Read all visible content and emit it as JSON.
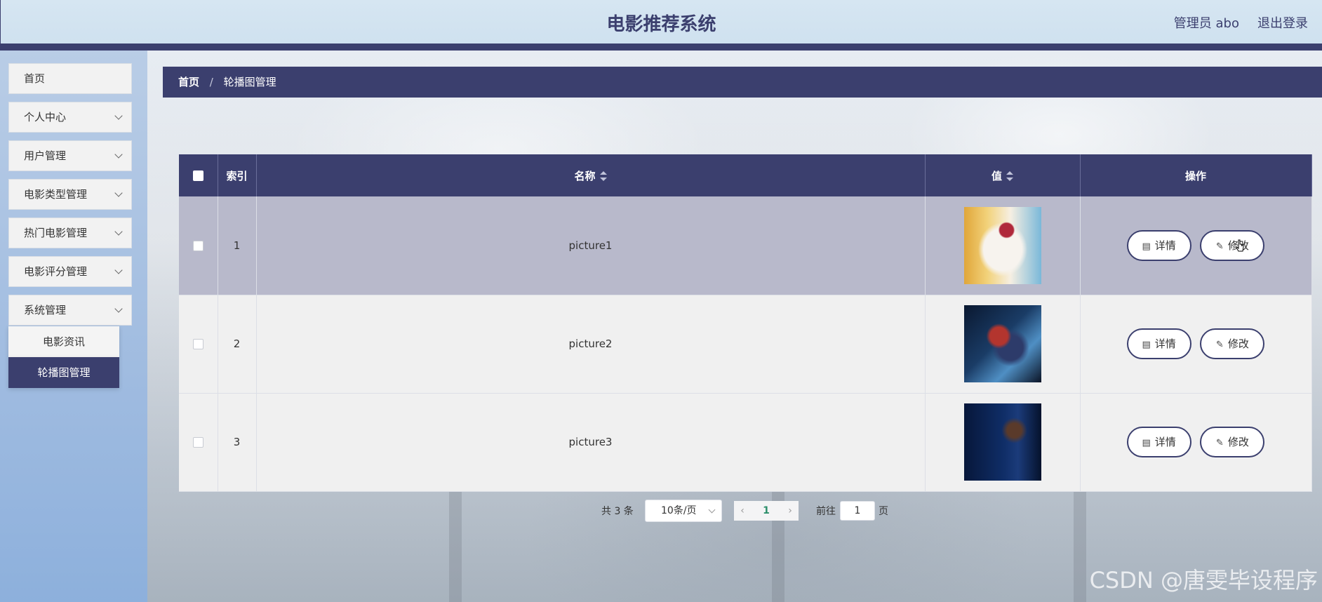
{
  "header": {
    "title": "电影推荐系统",
    "user": "管理员 abo",
    "logout": "退出登录"
  },
  "sidebar": {
    "items": [
      {
        "label": "首页"
      },
      {
        "label": "个人中心"
      },
      {
        "label": "用户管理"
      },
      {
        "label": "电影类型管理"
      },
      {
        "label": "热门电影管理"
      },
      {
        "label": "电影评分管理"
      },
      {
        "label": "系统管理"
      }
    ],
    "submenu": [
      {
        "label": "电影资讯",
        "active": false
      },
      {
        "label": "轮播图管理",
        "active": true
      }
    ]
  },
  "breadcrumb": {
    "home": "首页",
    "separator": "/",
    "current": "轮播图管理"
  },
  "table": {
    "columns": [
      "索引",
      "名称",
      "值",
      "操作"
    ],
    "rows": [
      {
        "index": "1",
        "name": "picture1",
        "image": "movie-poster-thumbnail"
      },
      {
        "index": "2",
        "name": "picture2",
        "image": "movie-poster-thumbnail"
      },
      {
        "index": "3",
        "name": "picture3",
        "image": "movie-poster-thumbnail"
      }
    ],
    "actions": {
      "detail": "详情",
      "edit": "修改"
    }
  },
  "pagination": {
    "total": "共 3 条",
    "page_size": "10条/页",
    "current_page": "1",
    "goto_label": "前往",
    "goto_value": "1",
    "unit": "页"
  },
  "watermark": "CSDN @唐雯毕设程序",
  "colors": {
    "primary": "#3b3f6e",
    "hover_row": "#b8b9cb",
    "header_bg": "#d6e6f2"
  }
}
